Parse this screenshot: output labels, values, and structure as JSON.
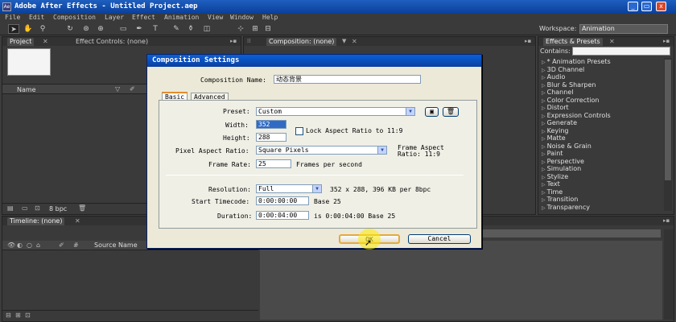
{
  "window": {
    "title": "Adobe After Effects - Untitled Project.aep",
    "minimize": "_",
    "restore": "▭",
    "close": "x"
  },
  "menu": [
    "File",
    "Edit",
    "Composition",
    "Layer",
    "Effect",
    "Animation",
    "View",
    "Window",
    "Help"
  ],
  "toolbar": {
    "workspace_label": "Workspace:",
    "workspace_value": "Animation"
  },
  "project_panel": {
    "tab_project": "Project",
    "tab_effect_controls": "Effect Controls: (none)",
    "column_name": "Name",
    "bit_depth": "8 bpc"
  },
  "comp_panel": {
    "tab": "Composition: (none)"
  },
  "effects_panel": {
    "tab": "Effects & Presets",
    "contains_label": "Contains:",
    "items": [
      "* Animation Presets",
      "3D Channel",
      "Audio",
      "Blur & Sharpen",
      "Channel",
      "Color Correction",
      "Distort",
      "Expression Controls",
      "Generate",
      "Keying",
      "Matte",
      "Noise & Grain",
      "Paint",
      "Perspective",
      "Simulation",
      "Stylize",
      "Text",
      "Time",
      "Transition",
      "Transparency"
    ]
  },
  "timeline": {
    "tab": "Timeline: (none)",
    "column_source_name": "Source Name"
  },
  "dialog": {
    "title": "Composition Settings",
    "comp_name_label": "Composition Name:",
    "comp_name_value": "动态背景",
    "tab_basic": "Basic",
    "tab_advanced": "Advanced",
    "preset_label": "Preset:",
    "preset_value": "Custom",
    "width_label": "Width:",
    "width_value": "352",
    "height_label": "Height:",
    "height_value": "288",
    "lock_aspect_label": "Lock Aspect Ratio to 11:9",
    "pixel_aspect_label": "Pixel Aspect Ratio:",
    "pixel_aspect_value": "Square Pixels",
    "frame_aspect_line1": "Frame Aspect",
    "frame_aspect_line2": "Ratio: 11:9",
    "frame_rate_label": "Frame Rate:",
    "frame_rate_value": "25",
    "frame_rate_unit": "Frames per second",
    "resolution_label": "Resolution:",
    "resolution_value": "Full",
    "resolution_info": "352 x 288, 396 KB per 8bpc",
    "start_timecode_label": "Start Timecode:",
    "start_timecode_value": "0:00:00:00",
    "start_timecode_base": "Base 25",
    "duration_label": "Duration:",
    "duration_value": "0:00:04:00",
    "duration_info": "is 0:00:04:00  Base 25",
    "ok_label": "OK",
    "cancel_label": "Cancel"
  }
}
